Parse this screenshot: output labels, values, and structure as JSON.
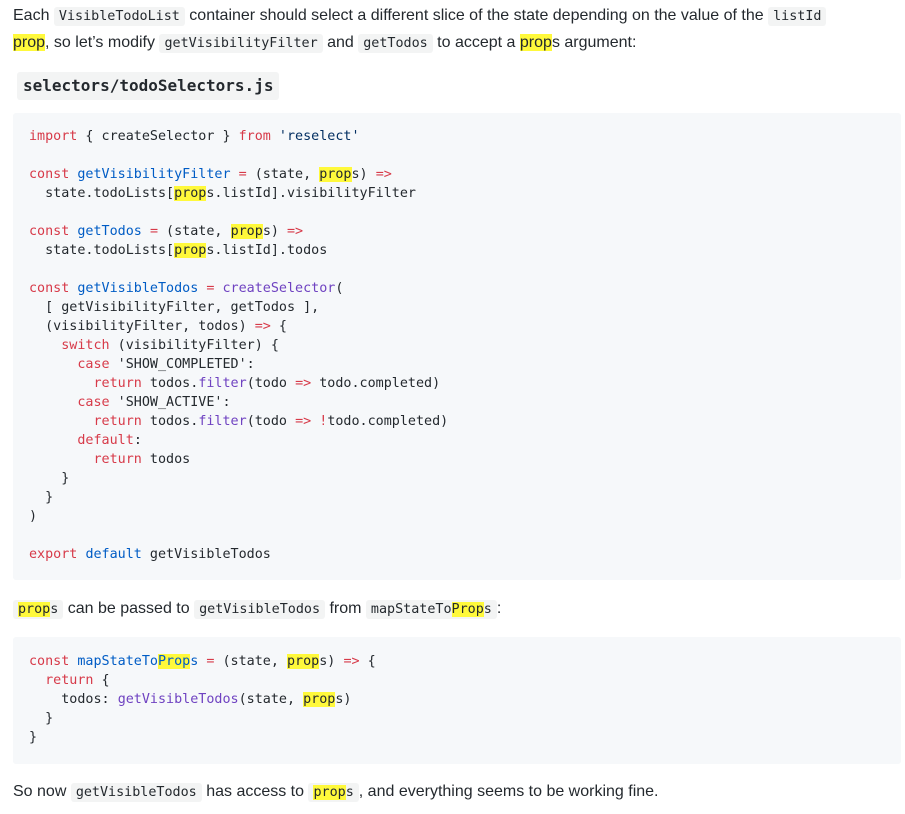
{
  "intro": {
    "t1": "Each ",
    "c1": "VisibleTodoList",
    "t2": " container should select a different slice of the state depending on the value of the ",
    "c2": "listId",
    "t3": " ",
    "hl1": "prop",
    "t4": ", so let’s modify ",
    "c3": "getVisibilityFilter",
    "t5": " and ",
    "c4": "getTodos",
    "t6": " to accept a ",
    "hl2": "prop",
    "t7": "s argument:"
  },
  "file_title": "selectors/todoSelectors.js",
  "code1": {
    "l1": [
      "import",
      " { createSelector } ",
      "from",
      " 'reselect'"
    ],
    "l2": [
      "const",
      " ",
      "getVisibilityFilter",
      " ",
      "=",
      " (state, ",
      "prop",
      "s) ",
      "=>"
    ],
    "l3": [
      "  state.todoLists[",
      "prop",
      "s.listId].visibilityFilter"
    ],
    "l4": [
      "const",
      " ",
      "getTodos",
      " ",
      "=",
      " (state, ",
      "prop",
      "s) ",
      "=>"
    ],
    "l5": [
      "  state.todoLists[",
      "prop",
      "s.listId].todos"
    ],
    "l6": [
      "const",
      " ",
      "getVisibleTodos",
      " ",
      "=",
      " ",
      "createSelector",
      "("
    ],
    "l7": "  [ getVisibilityFilter, getTodos ],",
    "l8": [
      "  (visibilityFilter, todos) ",
      "=>",
      " {"
    ],
    "l9": [
      "    ",
      "switch",
      " (visibilityFilter) {"
    ],
    "l10": [
      "      ",
      "case",
      " 'SHOW_COMPLETED':"
    ],
    "l11": [
      "        ",
      "return",
      " todos.",
      "filter",
      "(todo ",
      "=>",
      " todo.completed)"
    ],
    "l12": [
      "      ",
      "case",
      " 'SHOW_ACTIVE':"
    ],
    "l13": [
      "        ",
      "return",
      " todos.",
      "filter",
      "(todo ",
      "=>",
      " ",
      "!",
      "todo.completed)"
    ],
    "l14": [
      "      ",
      "default",
      ":"
    ],
    "l15": [
      "        ",
      "return",
      " todos"
    ],
    "l16": "    }",
    "l17": "  }",
    "l18": ")",
    "l19": [
      "export",
      " ",
      "default",
      " getVisibleTodos"
    ]
  },
  "para2": {
    "hl": "prop",
    "hl_rest": "s",
    "t1": " can be passed to ",
    "c1": "getVisibleTodos",
    "t2": " from ",
    "c2a": "mapStateTo",
    "c2hl": "Prop",
    "c2b": "s",
    "t3": ":"
  },
  "code2": {
    "l1": [
      "const",
      " ",
      "mapStateTo",
      "Prop",
      "s",
      " ",
      "=",
      " (state, ",
      "prop",
      "s) ",
      "=>",
      " {"
    ],
    "l2": [
      "  ",
      "return",
      " {"
    ],
    "l3": [
      "    todos: ",
      "getVisibleTodos",
      "(state, ",
      "prop",
      "s)"
    ],
    "l4": "  }",
    "l5": "}"
  },
  "outro": {
    "t1": "So now ",
    "c1": "getVisibleTodos",
    "t2": " has access to ",
    "c2hl": "prop",
    "c2b": "s",
    "t3": ", and everything seems to be working fine."
  }
}
